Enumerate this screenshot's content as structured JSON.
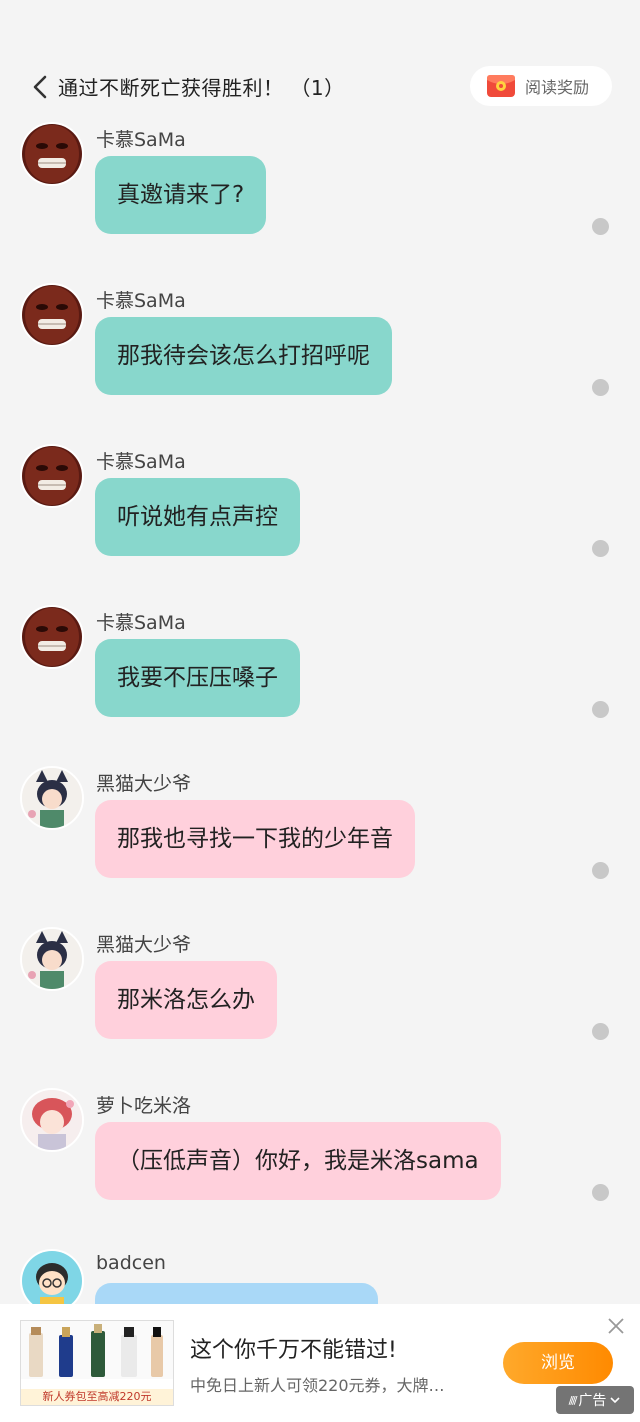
{
  "header": {
    "title": "通过不断死亡获得胜利！ （1）",
    "reward_label": "阅读奖励"
  },
  "messages": [
    {
      "sender": "卡慕SaMa",
      "text": "真邀请来了?",
      "bubble_color": "#88d7cc",
      "avatar": "meme-face"
    },
    {
      "sender": "卡慕SaMa",
      "text": "那我待会该怎么打招呼呢",
      "bubble_color": "#88d7cc",
      "avatar": "meme-face"
    },
    {
      "sender": "卡慕SaMa",
      "text": "听说她有点声控",
      "bubble_color": "#88d7cc",
      "avatar": "meme-face"
    },
    {
      "sender": "卡慕SaMa",
      "text": "我要不压压嗓子",
      "bubble_color": "#88d7cc",
      "avatar": "meme-face"
    },
    {
      "sender": "黑猫大少爷",
      "text": "那我也寻找一下我的少年音",
      "bubble_color": "#ffd0dc",
      "avatar": "anime-catboy"
    },
    {
      "sender": "黑猫大少爷",
      "text": "那米洛怎么办",
      "bubble_color": "#ffd0dc",
      "avatar": "anime-catboy"
    },
    {
      "sender": "萝卜吃米洛",
      "text": "（压低声音）你好，我是米洛sama",
      "bubble_color": "#ffd0dc",
      "avatar": "anime-redhair"
    },
    {
      "sender": "badcen",
      "text": "",
      "bubble_color": "#a9d8f7",
      "avatar": "cartoon-boy"
    }
  ],
  "ad": {
    "title": "这个你千万不能错过!",
    "description": "中免日上新人可领220元券，大牌…",
    "button_label": "浏览",
    "image_caption": "新人券包至高减220元",
    "badge_label": "广告"
  }
}
